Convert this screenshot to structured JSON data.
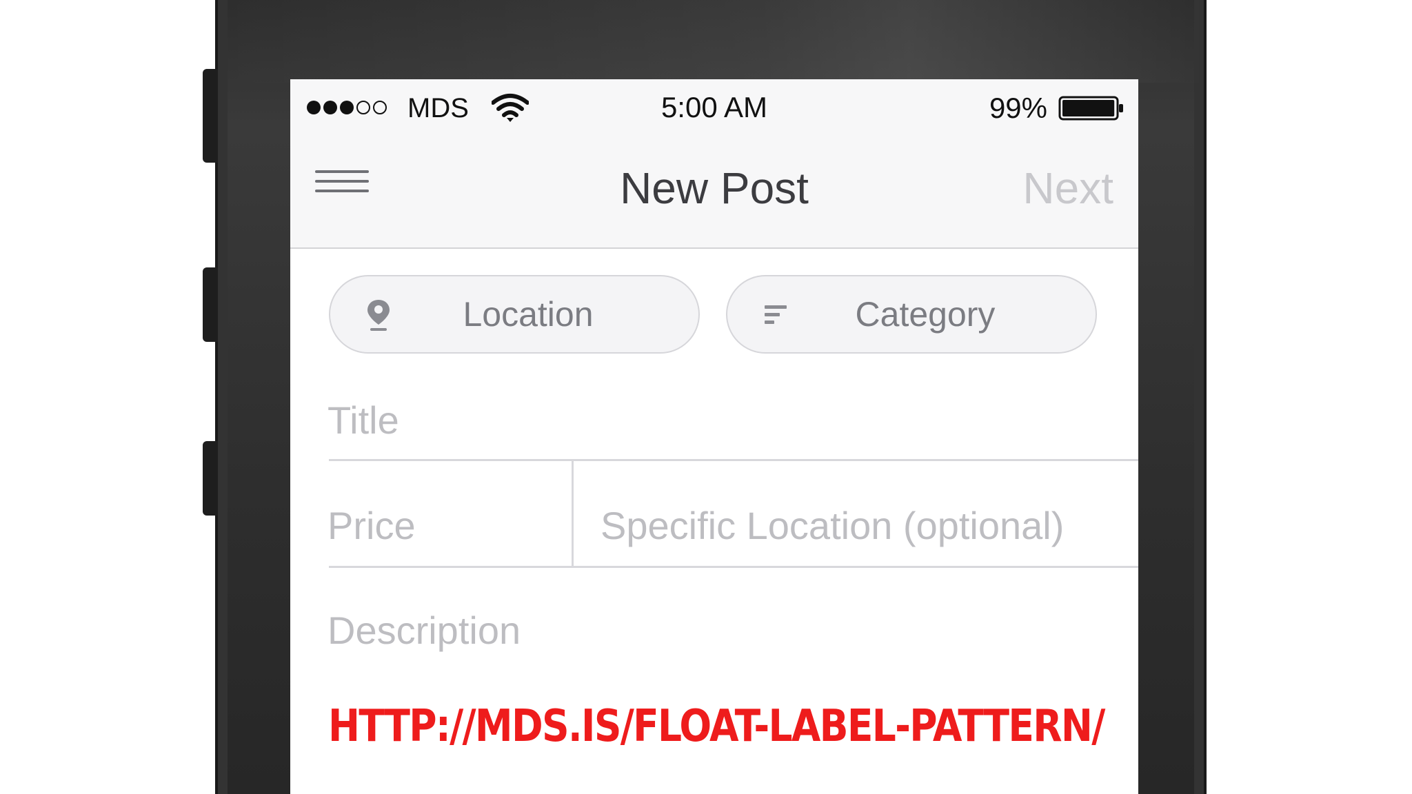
{
  "status_bar": {
    "carrier": "MDS",
    "time": "5:00 AM",
    "battery_percent": "99%",
    "signal_bars_filled": 3,
    "signal_bars_total": 5,
    "battery_level": 0.99
  },
  "nav_bar": {
    "title": "New Post",
    "next_label": "Next",
    "menu_icon": "hamburger-menu-icon"
  },
  "chips": {
    "location": {
      "label": "Location",
      "icon": "location-pin-icon"
    },
    "category": {
      "label": "Category",
      "icon": "list-lines-icon"
    }
  },
  "form": {
    "title_placeholder": "Title",
    "price_placeholder": "Price",
    "specific_location_placeholder": "Specific Location (optional)",
    "description_placeholder": "Description"
  },
  "caption": {
    "url": "HTTP://MDS.IS/FLOAT-LABEL-PATTERN/",
    "color": "#ee1c1c"
  }
}
